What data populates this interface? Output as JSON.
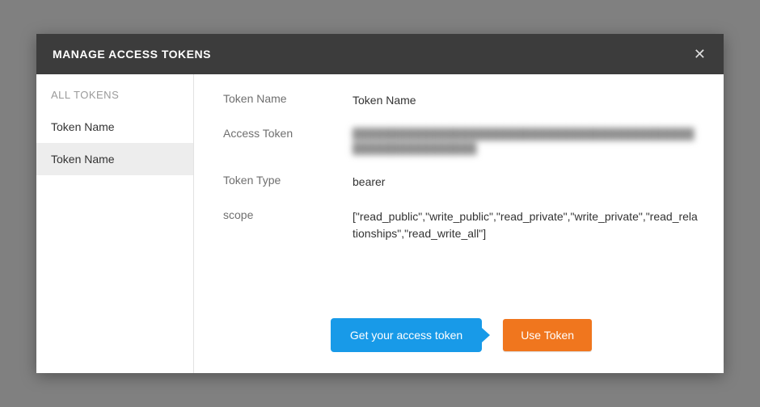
{
  "header": {
    "title": "MANAGE ACCESS TOKENS"
  },
  "sidebar": {
    "heading": "ALL TOKENS",
    "items": [
      {
        "label": "Token Name",
        "selected": false
      },
      {
        "label": "Token Name",
        "selected": true
      }
    ]
  },
  "details": {
    "name_label": "Token Name",
    "name_value": "Token Name",
    "access_token_label": "Access Token",
    "access_token_value": "████████████████████████████████████████████████████████████",
    "token_type_label": "Token Type",
    "token_type_value": "bearer",
    "scope_label": "scope",
    "scope_value": "[\"read_public\",\"write_public\",\"read_private\",\"write_private\",\"read_relationships\",\"read_write_all\"]"
  },
  "actions": {
    "callout": "Get your access token",
    "use_token": "Use Token"
  }
}
